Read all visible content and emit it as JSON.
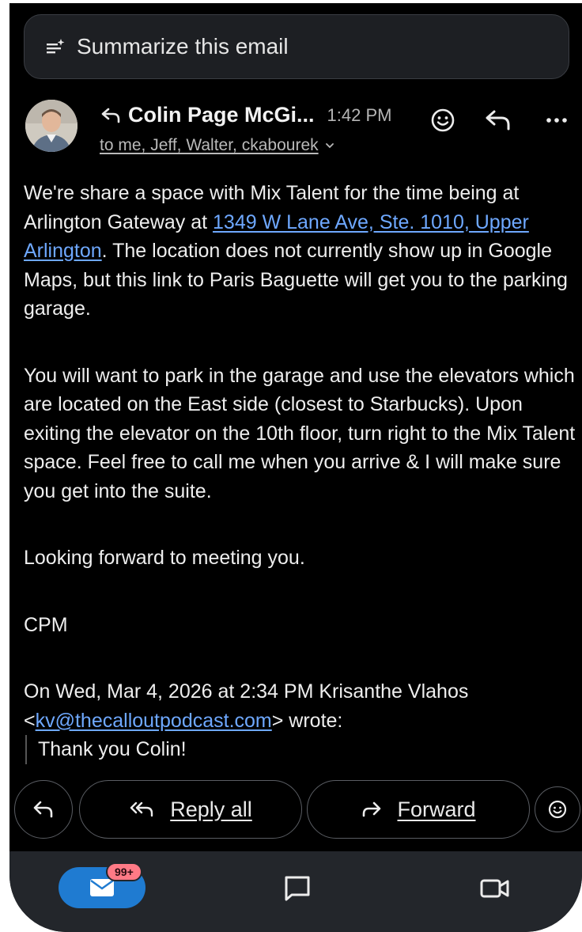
{
  "summarize": {
    "label": "Summarize this email"
  },
  "header": {
    "sender": "Colin Page McGi...",
    "time": "1:42 PM",
    "recipients": "to me, Jeff, Walter, ckabourek"
  },
  "body": {
    "p1_before_link": "We're share a space with Mix Talent for the time being at Arlington Gateway at ",
    "p1_link": "1349 W Lane Ave, Ste. 1010, Upper Arlington",
    "p1_after_link": ". The location does not currently show up in Google Maps, but this link to Paris Baguette will get you to the parking garage.",
    "p2": "You will want to park in the garage and use the elevators which are located on the East side (closest to Starbucks). Upon exiting the elevator on the 10th floor, turn right to the Mix Talent space. Feel free to call me when you arrive & I will make sure you get into the suite.",
    "p3": "Looking forward to meeting you.",
    "signature": "CPM",
    "quote_header": "On Wed, Mar 4, 2026 at 2:34 PM Krisanthe Vlahos",
    "quote_open": "<",
    "quote_email": "kv@thecalloutpodcast.com",
    "quote_close": "> wrote:",
    "quoted_text": "Thank you Colin!"
  },
  "actions": {
    "reply_all": "Reply all",
    "forward": "Forward"
  },
  "nav": {
    "mail_badge": "99+"
  },
  "colors": {
    "background": "#000000",
    "link": "#6ea8ff",
    "mail_pill": "#1f7bd1",
    "badge": "#ff7a86"
  },
  "icons": [
    "summarize-icon",
    "reply-icon",
    "emoji-icon",
    "more-icon",
    "reply-all-icon",
    "forward-icon",
    "mail-icon",
    "chat-icon",
    "video-icon"
  ]
}
